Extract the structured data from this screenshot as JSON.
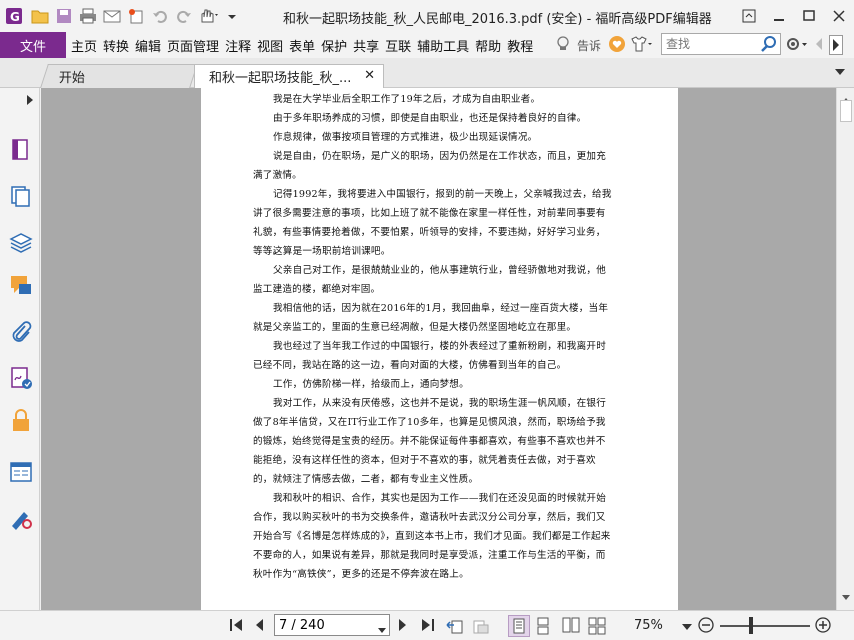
{
  "window": {
    "title": "和秋一起职场技能_秋_人民邮电_2016.3.pdf (安全) - 福昕高级PDF编辑器"
  },
  "menubar": {
    "file_label": "文件",
    "items": [
      "主页",
      "转换",
      "编辑",
      "页面管理",
      "注释",
      "视图",
      "表单",
      "保护",
      "共享",
      "互联",
      "辅助工具",
      "帮助",
      "教程"
    ],
    "tell_me": "告诉",
    "search_placeholder": "查找"
  },
  "tabs": [
    {
      "label": "开始"
    },
    {
      "label": "和秋一起职场技能_秋_..."
    }
  ],
  "document": {
    "paragraphs": [
      {
        "text": "我是在大学毕业后全职工作了19年之后，才成为自由职业者。"
      },
      {
        "text": "由于多年职场养成的习惯，即使是自由职业，也还是保持着良好的自律。"
      },
      {
        "text": "作息规律，做事按项目管理的方式推进，极少出现延误情况。"
      },
      {
        "text": "说是自由，仍在职场，是广义的职场，因为仍然是在工作状态，而且，更加充满了激情。"
      },
      {
        "text": "记得1992年，我将要进入中国银行，报到的前一天晚上，父亲喊我过去，给我讲了很多需要注意的事项，比如上班了就不能像在家里一样任性，对前辈同事要有礼貌，有些事情要抢着做，不要怕累，听领导的安排，不要违拗，好好学习业务，等等。"
      },
      {
        "text": "这算是一场职前培训课吧。"
      },
      {
        "text": "父亲自己对工作，是很兢兢业业的，他从事建筑行业，曾经骄傲地对我说，他监工建造的楼，都绝对牢固。"
      },
      {
        "text": "我相信他的话，因为就在2016年的1月，我回曲阜，经过一座百货大楼，当年就是父亲监工的，里面的生意已经凋敝，但是大楼仍然坚固地屹立在那里。"
      },
      {
        "text": "我也经过了当年我工作过的中国银行，楼的外表经过了重新粉刷，和我离开时已经不同，我站在路的这一边，看向对面的大楼，仿佛看到当年的自己。"
      },
      {
        "text": "工作，仿佛阶梯一样，拾级而上，通向梦想。"
      },
      {
        "text": "我对工作，从来没有厌倦感，这也并不是说，我的职场生涯一帆风顺，在银行做了8年半信贷，又在IT行业工作了10多年，也算是见惯风浪，然而，职场给予我的锻炼，始终觉得是宝贵的经历。并不能保证每件事都喜欢，有些事不喜欢也并不能拒绝，没有这样任性的资本，但对于不喜欢的事，就凭着责任去做，对于喜欢的，就倾注了情感去做，二者，都有专业主义性质。"
      },
      {
        "text": "我和秋叶的相识、合作，其实也是因为工作——我们在还没见面的时候就开始合作，我以购买秋叶的书为交换条件，邀请秋叶去武汉分公司分享，然后，我们又开始合写《名博是怎样炼成的》，直到这本书上市，我们才见面。我们都是工作起来不要命的人，如果说有差异，那就是我同时是享受派，注重工作与生活的平衡，而秋叶作为“高铁侠”，更多的还是不停奔波在路上。"
      }
    ]
  },
  "statusbar": {
    "page_value": "7 / 240",
    "zoom": "75%"
  },
  "colors": {
    "file_button_bg": "#7b2a8e",
    "doc_background": "#a9a9a9",
    "accent_red": "#d0314a"
  }
}
